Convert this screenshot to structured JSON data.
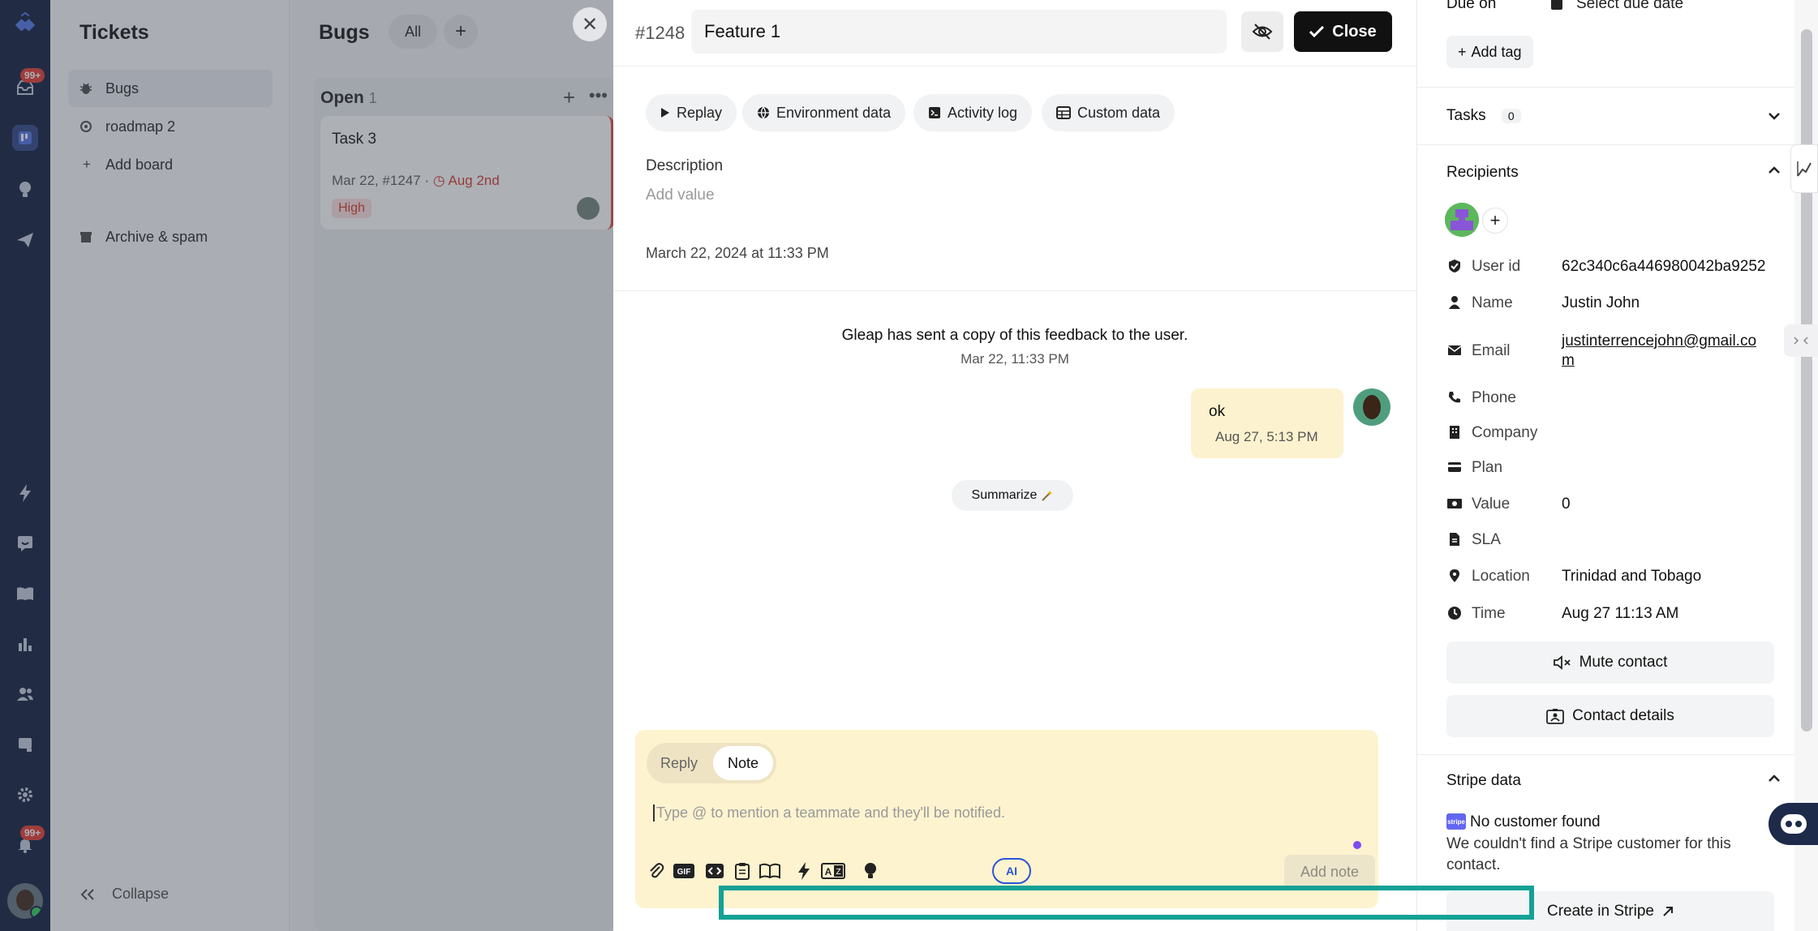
{
  "rail": {
    "badge_top": "99+",
    "badge_bottom": "99+"
  },
  "sidebar": {
    "title": "Tickets",
    "items": [
      {
        "label": "Bugs"
      },
      {
        "label": "roadmap 2"
      },
      {
        "label": "Add board"
      },
      {
        "label": "Archive & spam"
      }
    ],
    "collapse_label": "Collapse"
  },
  "board": {
    "title": "Bugs",
    "filter_all": "All",
    "add": "+",
    "column": {
      "name": "Open",
      "count": "1"
    },
    "card": {
      "title": "Task 3",
      "meta": "Mar 22, #1247 · ",
      "due": "Aug 2nd",
      "priority": "High"
    }
  },
  "modal": {
    "ticket_number": "#1248",
    "title": "Feature 1",
    "close_label": "Close",
    "tabs": [
      {
        "label": "Replay",
        "icon": "play-icon"
      },
      {
        "label": "Environment data",
        "icon": "globe-icon"
      },
      {
        "label": "Activity log",
        "icon": "terminal-icon"
      },
      {
        "label": "Custom data",
        "icon": "table-icon"
      }
    ],
    "description_label": "Description",
    "description_placeholder": "Add value",
    "created_at": "March 22, 2024 at 11:33 PM",
    "system_message": "Gleap has sent a copy of this feedback to the user.",
    "system_time": "Mar 22, 11:33 PM",
    "message": {
      "text": "ok",
      "time": "Aug 27, 5:13 PM"
    },
    "summarize_label": "Summarize",
    "composer": {
      "mode_reply": "Reply",
      "mode_note": "Note",
      "placeholder": "Type @ to mention a teammate and they'll be notified.",
      "ai_label": "AI",
      "submit_label": "Add note"
    }
  },
  "right_panel": {
    "due_label": "Due on",
    "due_value": "Select due date",
    "add_tag": "Add tag",
    "tasks_label": "Tasks",
    "tasks_count": "0",
    "recipients_label": "Recipients",
    "contact": [
      {
        "icon": "shield-check-icon",
        "label": "User id",
        "value": "62c340c6a446980042ba9252"
      },
      {
        "icon": "person-icon",
        "label": "Name",
        "value": "Justin John"
      },
      {
        "icon": "envelope-icon",
        "label": "Email",
        "value_line1": "justinterrencejohn@gmail.co",
        "value_line2": "m"
      },
      {
        "icon": "phone-icon",
        "label": "Phone",
        "value": ""
      },
      {
        "icon": "building-icon",
        "label": "Company",
        "value": ""
      },
      {
        "icon": "credit-card-icon",
        "label": "Plan",
        "value": ""
      },
      {
        "icon": "money-icon",
        "label": "Value",
        "value": "0"
      },
      {
        "icon": "file-icon",
        "label": "SLA",
        "value": ""
      },
      {
        "icon": "location-pin-icon",
        "label": "Location",
        "value": "Trinidad and Tobago"
      },
      {
        "icon": "clock-icon",
        "label": "Time",
        "value": "Aug 27 11:13 AM"
      }
    ],
    "mute_contact": "Mute contact",
    "contact_details": "Contact details",
    "stripe_label": "Stripe data",
    "stripe_badge": "stripe",
    "stripe_not_found": "No customer found",
    "stripe_note": "We couldn't find a Stripe customer for this contact.",
    "create_in_stripe": "Create in Stripe"
  },
  "colors": {
    "accent": "#14a195",
    "close_bg": "#111111",
    "composer_bg": "#fdf3cf",
    "rail_bg": "#1e2a4a"
  }
}
